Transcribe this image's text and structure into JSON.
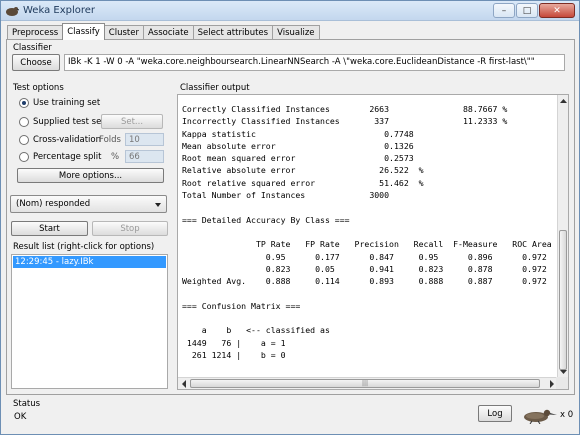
{
  "window": {
    "title": "Weka Explorer",
    "minimize_glyph": "–",
    "maximize_glyph": "□",
    "close_glyph": "✕"
  },
  "tabs": [
    {
      "label": "Preprocess",
      "active": false
    },
    {
      "label": "Classify",
      "active": true
    },
    {
      "label": "Cluster",
      "active": false
    },
    {
      "label": "Associate",
      "active": false
    },
    {
      "label": "Select attributes",
      "active": false
    },
    {
      "label": "Visualize",
      "active": false
    }
  ],
  "classifier": {
    "section_label": "Classifier",
    "choose_label": "Choose",
    "command": "IBk -K 1 -W 0 -A \"weka.core.neighboursearch.LinearNNSearch -A \\\"weka.core.EuclideanDistance -R first-last\\\"\""
  },
  "test_options": {
    "section_label": "Test options",
    "options": [
      {
        "label": "Use training set",
        "selected": true
      },
      {
        "label": "Supplied test set",
        "selected": false
      },
      {
        "label": "Cross-validation",
        "selected": false
      },
      {
        "label": "Percentage split",
        "selected": false
      }
    ],
    "set_button": "Set...",
    "folds_label": "Folds",
    "folds_value": "10",
    "percent_label": "%",
    "percent_value": "66",
    "more_options": "More options..."
  },
  "class_select": {
    "value": "(Nom) responded"
  },
  "actions": {
    "start": "Start",
    "stop": "Stop"
  },
  "result_list": {
    "label": "Result list (right-click for options)",
    "items": [
      "12:29:45 - lazy.IBk"
    ]
  },
  "output": {
    "label": "Classifier output",
    "lines": [
      "Correctly Classified Instances        2663               88.7667 %",
      "Incorrectly Classified Instances       337               11.2333 %",
      "Kappa statistic                          0.7748",
      "Mean absolute error                      0.1326",
      "Root mean squared error                  0.2573",
      "Relative absolute error                 26.522  %",
      "Root relative squared error             51.462  %",
      "Total Number of Instances             3000",
      "",
      "=== Detailed Accuracy By Class ===",
      "",
      "               TP Rate   FP Rate   Precision   Recall  F-Measure   ROC Area",
      "                 0.95      0.177      0.847     0.95      0.896      0.972",
      "                 0.823     0.05       0.941     0.823     0.878      0.972",
      "Weighted Avg.    0.888     0.114      0.893     0.888     0.887      0.972",
      "",
      "=== Confusion Matrix ===",
      "",
      "    a    b   <-- classified as",
      " 1449   76 |    a = 1",
      "  261 1214 |    b = 0"
    ]
  },
  "status": {
    "section_label": "Status",
    "text": "OK",
    "log_button": "Log",
    "x_count": "x 0"
  },
  "colors": {
    "selection": "#3399ff",
    "title_text": "#1e395b"
  }
}
